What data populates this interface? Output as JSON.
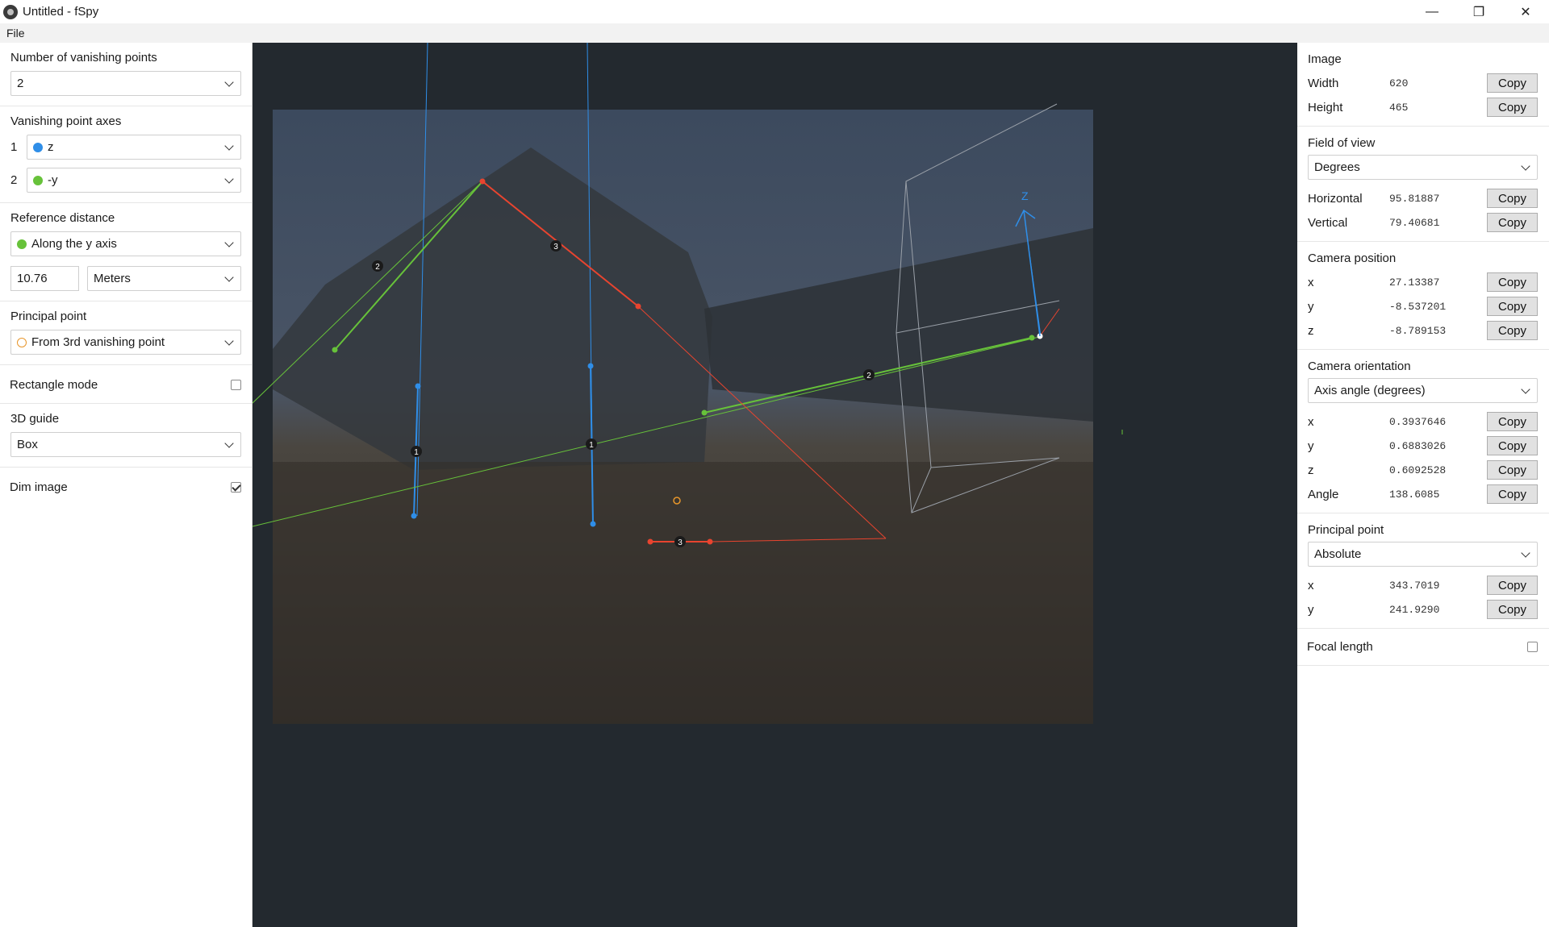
{
  "window": {
    "title": "Untitled - fSpy",
    "minimize": "—",
    "maximize": "❐",
    "close": "✕"
  },
  "menu": {
    "file": "File"
  },
  "left": {
    "num_vp_label": "Number of vanishing points",
    "num_vp_value": "2",
    "vp_axes_label": "Vanishing point axes",
    "vp_axes": [
      {
        "index": "1",
        "value": "z",
        "color": "#2f8ee8"
      },
      {
        "index": "2",
        "value": "-y",
        "color": "#67c23a"
      }
    ],
    "ref_distance_label": "Reference distance",
    "ref_distance_axis": "Along the y axis",
    "ref_distance_value": "10.76",
    "ref_distance_unit": "Meters",
    "principal_point_label": "Principal point",
    "principal_point_value": "From 3rd vanishing point",
    "rect_mode_label": "Rectangle mode",
    "rect_mode_checked": false,
    "guide_label": "3D guide",
    "guide_value": "Box",
    "dim_image_label": "Dim image",
    "dim_image_checked": true
  },
  "right": {
    "copy_label": "Copy",
    "image": {
      "title": "Image",
      "rows": [
        {
          "k": "Width",
          "v": "620"
        },
        {
          "k": "Height",
          "v": "465"
        }
      ]
    },
    "fov": {
      "title": "Field of view",
      "select": "Degrees",
      "rows": [
        {
          "k": "Horizontal",
          "v": "95.81887"
        },
        {
          "k": "Vertical",
          "v": "79.40681"
        }
      ]
    },
    "camera_position": {
      "title": "Camera position",
      "rows": [
        {
          "k": "x",
          "v": "27.13387"
        },
        {
          "k": "y",
          "v": "-8.537201"
        },
        {
          "k": "z",
          "v": "-8.789153"
        }
      ]
    },
    "camera_orientation": {
      "title": "Camera orientation",
      "select": "Axis angle (degrees)",
      "rows": [
        {
          "k": "x",
          "v": "0.3937646"
        },
        {
          "k": "y",
          "v": "0.6883026"
        },
        {
          "k": "z",
          "v": "0.6092528"
        },
        {
          "k": "Angle",
          "v": "138.6085"
        }
      ]
    },
    "principal_point": {
      "title": "Principal point",
      "select": "Absolute",
      "rows": [
        {
          "k": "x",
          "v": "343.7019"
        },
        {
          "k": "y",
          "v": "241.9290"
        }
      ]
    },
    "focal_length_label": "Focal length",
    "focal_length_checked": false
  },
  "canvas": {
    "handle_labels": {
      "one": "1",
      "two": "2",
      "three": "3"
    },
    "axis_z_label": "Z",
    "colors": {
      "x_axis": "#e8442f",
      "y_axis": "#67c23a",
      "z_axis": "#2f8ee8",
      "principal": "#e8962b",
      "bg": "#23292f"
    }
  }
}
